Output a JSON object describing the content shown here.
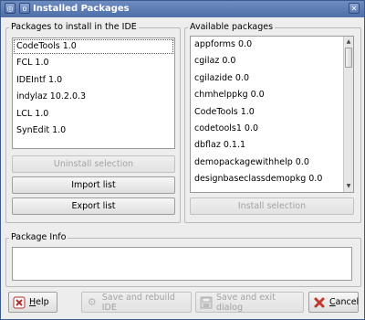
{
  "window": {
    "title": "Installed Packages"
  },
  "install_group": {
    "label": "Packages to install in the IDE",
    "items": [
      "CodeTools 1.0",
      "FCL 1.0",
      "IDEIntf 1.0",
      "indylaz 10.2.0.3",
      "LCL 1.0",
      "SynEdit 1.0"
    ],
    "selected_index": 0,
    "uninstall_label": "Uninstall selection",
    "import_label": "Import list",
    "export_label": "Export list"
  },
  "available_group": {
    "label": "Available packages",
    "items": [
      "appforms 0.0",
      "cgilaz 0.0",
      "cgilazide 0.0",
      "chmhelppkg 0.0",
      "CodeTools 1.0",
      "codetools1 0.0",
      "dbflaz 0.1.1",
      "demopackagewithhelp 0.0",
      "designbaseclassdemopkg 0.0"
    ],
    "install_label": "Install selection"
  },
  "package_info": {
    "label": "Package Info",
    "text": ""
  },
  "buttons": {
    "help_first": "H",
    "help_rest": "elp",
    "save_rebuild": "Save and rebuild IDE",
    "save_exit": "Save and exit dialog",
    "cancel_first": "C",
    "cancel_rest": "ancel"
  },
  "icons": {
    "window_menu": "menu-icon",
    "close": "close-icon",
    "help": "help-icon",
    "rebuild": "gear-icon",
    "save": "save-icon",
    "cancel": "cancel-icon"
  },
  "colors": {
    "titlebar": "#5b79b2",
    "cancel_icon": "#c0392b"
  }
}
